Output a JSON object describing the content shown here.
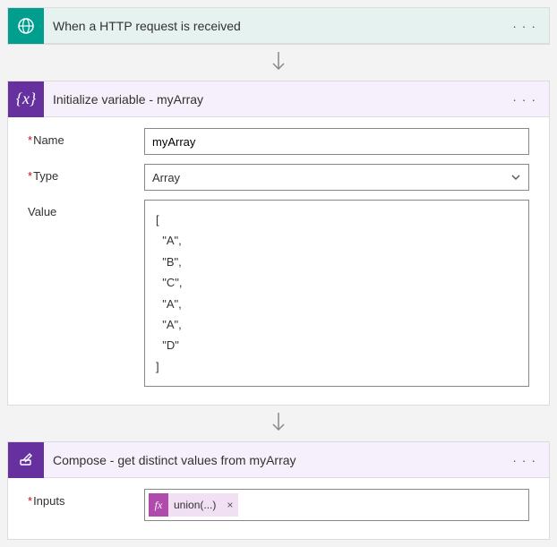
{
  "colors": {
    "trigger_bg": "#e6f2f0",
    "action_bg": "#f5f0fb",
    "purple": "#66319f",
    "teal": "#009e8f",
    "token_bg": "#f1dff3",
    "token_fx_bg": "#b04aad"
  },
  "trigger": {
    "title": "When a HTTP request is received",
    "icon_glyph": "⊕",
    "more": "· · ·"
  },
  "init_variable": {
    "title": "Initialize variable - myArray",
    "icon_glyph": "{x}",
    "more": "· · ·",
    "fields": {
      "name_label": "Name",
      "name_value": "myArray",
      "type_label": "Type",
      "type_value": "Array",
      "value_label": "Value",
      "value_content": "[\n  \"A\",\n  \"B\",\n  \"C\",\n  \"A\",\n  \"A\",\n  \"D\"\n]"
    }
  },
  "compose": {
    "title": "Compose - get distinct values from myArray",
    "icon_glyph": "✎",
    "more": "· · ·",
    "inputs_label": "Inputs",
    "token": {
      "fx_glyph": "fx",
      "text": "union(...)",
      "remove_glyph": "×"
    }
  }
}
